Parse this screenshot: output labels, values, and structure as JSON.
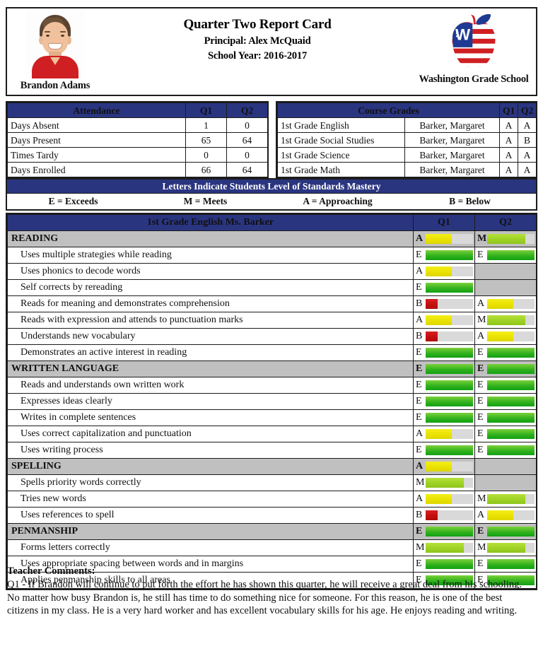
{
  "header": {
    "student_name": "Brandon Adams",
    "title": "Quarter Two Report Card",
    "principal": "Principal: Alex McQuaid",
    "school_year": "School Year: 2016-2017",
    "school_name": "Washington Grade School",
    "logo_letter": "W"
  },
  "attendance": {
    "title": "Attendance",
    "col_q1": "Q1",
    "col_q2": "Q2",
    "rows": [
      {
        "label": "Days Absent",
        "q1": "1",
        "q2": "0"
      },
      {
        "label": "Days Present",
        "q1": "65",
        "q2": "64"
      },
      {
        "label": "Times Tardy",
        "q1": "0",
        "q2": "0"
      },
      {
        "label": "Days Enrolled",
        "q1": "66",
        "q2": "64"
      }
    ]
  },
  "courses": {
    "title": "Course Grades",
    "col_q1": "Q1",
    "col_q2": "Q2",
    "rows": [
      {
        "course": "1st Grade English",
        "teacher": "Barker, Margaret",
        "q1": "A",
        "q2": "A"
      },
      {
        "course": "1st Grade Social Studies",
        "teacher": "Barker, Margaret",
        "q1": "A",
        "q2": "B"
      },
      {
        "course": "1st Grade Science",
        "teacher": "Barker, Margaret",
        "q1": "A",
        "q2": "A"
      },
      {
        "course": "1st Grade Math",
        "teacher": "Barker, Margaret",
        "q1": "A",
        "q2": "A"
      }
    ]
  },
  "legend": {
    "title": "Letters Indicate Students Level of Standards Mastery",
    "items": [
      "E = Exceeds",
      "M = Meets",
      "A = Approaching",
      "B = Below"
    ]
  },
  "standards": {
    "title": "1st Grade English Ms. Barker",
    "col_q1": "Q1",
    "col_q2": "Q2",
    "rows": [
      {
        "type": "section",
        "label": "READING",
        "q1": "A",
        "q2": "M"
      },
      {
        "type": "item",
        "label": "Uses multiple strategies while reading",
        "q1": "E",
        "q2": "E"
      },
      {
        "type": "item",
        "label": "Uses phonics to decode words",
        "q1": "A",
        "q2": ""
      },
      {
        "type": "item",
        "label": "Self corrects by rereading",
        "q1": "E",
        "q2": ""
      },
      {
        "type": "item",
        "label": "Reads for meaning and demonstrates comprehension",
        "q1": "B",
        "q2": "A"
      },
      {
        "type": "item",
        "label": "Reads with expression and attends to punctuation marks",
        "q1": "A",
        "q2": "M"
      },
      {
        "type": "item",
        "label": "Understands new vocabulary",
        "q1": "B",
        "q2": "A"
      },
      {
        "type": "item",
        "label": "Demonstrates an active interest in reading",
        "q1": "E",
        "q2": "E"
      },
      {
        "type": "section",
        "label": "WRITTEN LANGUAGE",
        "q1": "E",
        "q2": "E"
      },
      {
        "type": "item",
        "label": "Reads and understands own written work",
        "q1": "E",
        "q2": "E"
      },
      {
        "type": "item",
        "label": "Expresses ideas clearly",
        "q1": "E",
        "q2": "E"
      },
      {
        "type": "item",
        "label": "Writes in complete sentences",
        "q1": "E",
        "q2": "E"
      },
      {
        "type": "item",
        "label": "Uses correct capitalization and punctuation",
        "q1": "A",
        "q2": "E"
      },
      {
        "type": "item",
        "label": "Uses writing process",
        "q1": "E",
        "q2": "E"
      },
      {
        "type": "section",
        "label": "SPELLING",
        "q1": "A",
        "q2": ""
      },
      {
        "type": "item",
        "label": "Spells priority words correctly",
        "q1": "M",
        "q2": ""
      },
      {
        "type": "item",
        "label": "Tries new words",
        "q1": "A",
        "q2": "M"
      },
      {
        "type": "item",
        "label": "Uses references to spell",
        "q1": "B",
        "q2": "A"
      },
      {
        "type": "section",
        "label": "PENMANSHIP",
        "q1": "E",
        "q2": "E"
      },
      {
        "type": "item",
        "label": "Forms letters correctly",
        "q1": "M",
        "q2": "M"
      },
      {
        "type": "item",
        "label": "Uses appropriate spacing between words and in margins",
        "q1": "E",
        "q2": "E"
      },
      {
        "type": "item",
        "label": "Applies penmanship skills to all areas",
        "q1": "E",
        "q2": "E"
      }
    ]
  },
  "comments": {
    "title": "Teacher Comments:",
    "body": "Q1 - If Brandon will continue to put forth the effort he has shown this quarter, he will receive a great deal from his schooling. No matter how busy Brandon is, he still has time to do something nice for someone. For this reason, he is one of the best citizens in my class. He is a very hard worker and has excellent vocabulary skills for his age. He enjoys reading and writing."
  },
  "mark_scale": {
    "E": 100,
    "M": 80,
    "A": 55,
    "B": 25
  },
  "colors": {
    "navy": "#2a3580",
    "section_gray": "#c0c0c0",
    "track_gray": "#d9d9d9",
    "exceeds_green": "#33b21e",
    "meets_yellowgreen": "#9ed225",
    "approaching_yellow": "#e8e000",
    "below_red": "#c40f0f",
    "logo_red": "#cf1f22",
    "logo_blue": "#1f3a93"
  }
}
